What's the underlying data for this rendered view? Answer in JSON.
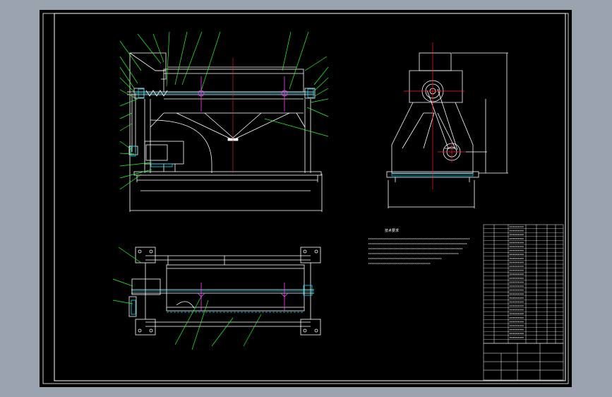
{
  "window": {
    "background_color": "#9aa3ae",
    "paper_color": "#000000",
    "frame_color": "#ffffff"
  },
  "drawing": {
    "line_colors": {
      "outline": "#ffffff",
      "leader": "#22ff22",
      "centerline": "#ff2020",
      "hidden": "#00e0ff",
      "highlight": "#ff40ff"
    },
    "views": [
      "front-view",
      "side-view",
      "top-view"
    ]
  },
  "notes": {
    "title": "技术要求",
    "lines": [
      "",
      "",
      "",
      "",
      "",
      ""
    ]
  },
  "title_block": {
    "drawing_name": "",
    "drawing_number": ""
  }
}
